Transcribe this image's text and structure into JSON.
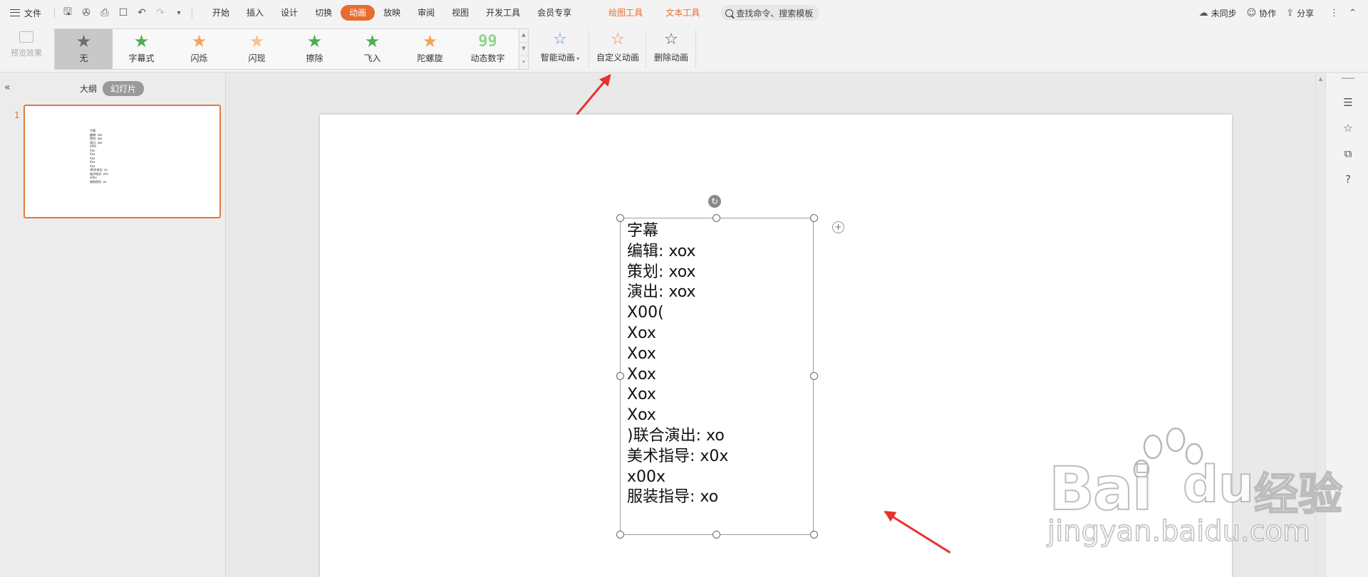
{
  "menubar": {
    "file_label": "文件",
    "tabs": [
      {
        "label": "开始"
      },
      {
        "label": "插入"
      },
      {
        "label": "设计"
      },
      {
        "label": "切换"
      },
      {
        "label": "动画",
        "active": true
      },
      {
        "label": "放映"
      },
      {
        "label": "审阅"
      },
      {
        "label": "视图"
      },
      {
        "label": "开发工具"
      },
      {
        "label": "会员专享"
      }
    ],
    "context_tabs": [
      "绘图工具",
      "文本工具"
    ],
    "search_placeholder": "查找命令、搜索模板",
    "right": {
      "sync_label": "未同步",
      "collab_label": "协作",
      "share_label": "分享"
    },
    "accent_color": "#e86c30"
  },
  "ribbon": {
    "preview_label": "预览效果",
    "gallery": [
      {
        "label": "无",
        "icon": "star-gray-icon",
        "color": "#707070",
        "selected": true
      },
      {
        "label": "字幕式",
        "icon": "star-green-icon",
        "color": "#4caf50"
      },
      {
        "label": "闪烁",
        "icon": "star-orange-icon",
        "color": "#f5a35a"
      },
      {
        "label": "闪现",
        "icon": "star-fade-orange-icon",
        "color": "#f8c28e"
      },
      {
        "label": "擦除",
        "icon": "star-wipe-green-icon",
        "color": "#4caf50"
      },
      {
        "label": "飞入",
        "icon": "star-fly-green-icon",
        "color": "#4caf50"
      },
      {
        "label": "陀螺旋",
        "icon": "star-spin-orange-icon",
        "color": "#f5a35a"
      },
      {
        "label": "动态数字",
        "icon": "number-99-icon",
        "glyph": "99"
      }
    ],
    "smart_anim_label": "智能动画",
    "custom_anim_label": "自定义动画",
    "delete_anim_label": "删除动画"
  },
  "left_panel": {
    "outline_tab": "大纲",
    "slides_tab": "幻灯片",
    "slide_number": "1",
    "thumb_text": "字幕\n编辑: xox\n策划: xox\n演出: xox\nX00(\nXox\nXox\nXox\nXox\nXox\n)联合演出: xo\n美术指导: x0x\nx00x\n服装指导: xo"
  },
  "slide": {
    "lines": [
      "字幕",
      "编辑: xox",
      "策划: xox",
      "演出: xox",
      "X00(",
      "Xox",
      "Xox",
      "Xox",
      "Xox",
      "Xox",
      ")联合演出: xo",
      "美术指导: x0x",
      "x00x",
      "服装指导: xo"
    ]
  },
  "watermark": {
    "brand": "Bai",
    "brand_du": "du",
    "suffix": "经验",
    "url": "jingyan.baidu.com"
  }
}
